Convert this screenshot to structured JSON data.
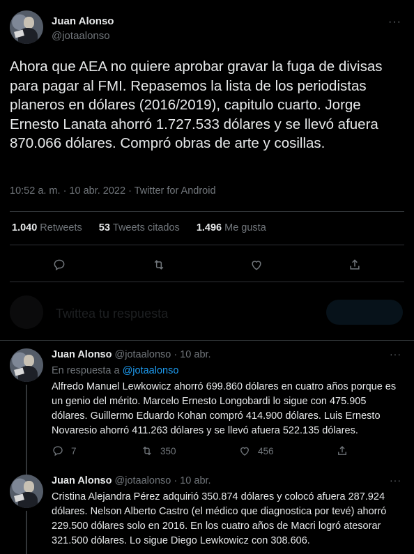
{
  "main_tweet": {
    "name": "Juan Alonso",
    "handle": "@jotaalonso",
    "more": "···",
    "text": "Ahora que AEA no quiere aprobar gravar la fuga de divisas para pagar al FMI. Repasemos la lista de los periodistas planeros en dólares (2016/2019), capitulo cuarto. Jorge Ernesto Lanata ahorró 1.727.533 dólares y se llevó afuera 870.066 dólares. Compró obras de arte y cosillas.",
    "timestamp": "10:52 a. m. · 10 abr. 2022 · Twitter for Android",
    "stats": {
      "retweets_count": "1.040",
      "retweets_label": "Retweets",
      "quotes_count": "53",
      "quotes_label": "Tweets citados",
      "likes_count": "1.496",
      "likes_label": "Me gusta"
    }
  },
  "reply_box": {
    "placeholder": "Twittea tu respuesta"
  },
  "replies": [
    {
      "name": "Juan Alonso",
      "handle_date": "@jotaalonso · 10 abr.",
      "in_reply_prefix": "En respuesta a",
      "in_reply_handle": "@jotaalonso",
      "text": "Alfredo Manuel Lewkowicz ahorró 699.860 dólares en cuatro años porque es un genio del mérito. Marcelo Ernesto Longobardi lo sigue con 475.905 dólares. Guillermo Eduardo Kohan compró 414.900 dólares. Luis Ernesto Novaresio ahorró 411.263 dólares y se llevó afuera 522.135 dólares.",
      "replies": "7",
      "retweets": "350",
      "likes": "456"
    },
    {
      "name": "Juan Alonso",
      "handle_date": "@jotaalonso · 10 abr.",
      "text": "Cristina Alejandra Pérez adquirió 350.874 dólares y colocó afuera 287.924 dólares. Nelson Alberto Castro (el médico que diagnostica por tevé) ahorró 229.500 dólares solo en 2016. En los cuatro años de Macri logró atesorar 321.500 dólares. Lo sigue Diego Lewkowicz con 308.606."
    }
  ],
  "icons": {
    "reply": "reply-icon",
    "retweet": "retweet-icon",
    "like": "heart-icon",
    "share": "share-icon",
    "more": "more-icon"
  },
  "colors": {
    "background": "#000000",
    "text": "#e7e9ea",
    "muted": "#71767b",
    "accent": "#1d9bf0",
    "separator": "#2f3336"
  }
}
